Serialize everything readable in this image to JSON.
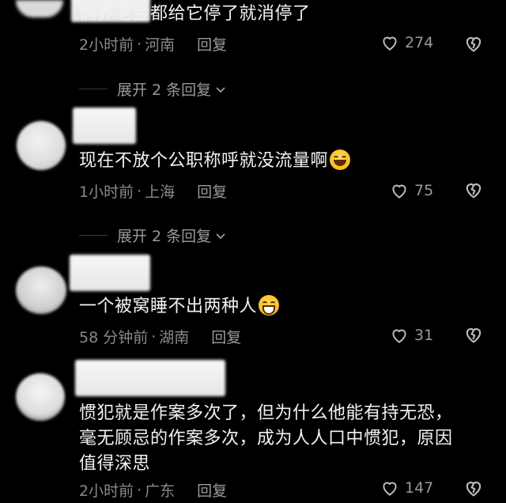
{
  "comments": [
    {
      "text": "俩养老金都给它停了就消停了",
      "time": "2小时前",
      "location": "河南",
      "reply_label": "回复",
      "likes": "274",
      "expand_label": "展开 2 条回复"
    },
    {
      "text": "现在不放个公职称呼就没流量啊",
      "emoji": "rofl-emoji",
      "time": "1小时前",
      "location": "上海",
      "reply_label": "回复",
      "likes": "75",
      "expand_label": "展开 2 条回复"
    },
    {
      "text": "一个被窝睡不出两种人",
      "emoji": "grin-sweat-emoji",
      "time": "58 分钟前",
      "location": "湖南",
      "reply_label": "回复",
      "likes": "31"
    },
    {
      "text": "惯犯就是作案多次了，但为什么他能有持无恐，毫无顾忌的作案多次，成为人人口中惯犯，原因值得深思",
      "time": "2小时前",
      "location": "广东",
      "reply_label": "回复",
      "likes": "147"
    }
  ],
  "separator": "·",
  "icons": {
    "like": "heart-outline-icon",
    "dislike": "broken-heart-icon",
    "expand": "chevron-down-icon"
  },
  "colors": {
    "background": "#000000",
    "text": "#f2f2f2",
    "meta": "#8a8a8a"
  }
}
